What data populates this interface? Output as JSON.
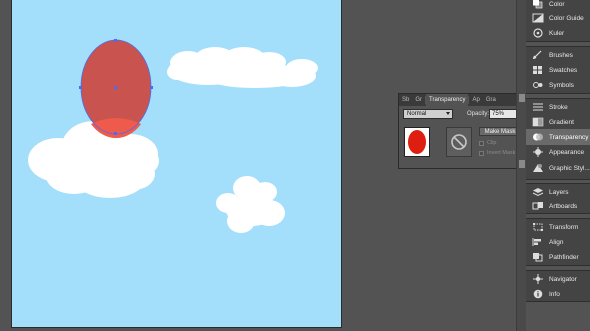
{
  "colors": {
    "workspace": "#535353",
    "artboard": "#a3defa",
    "balloon_fill": "#c9544f",
    "balloon_highlight": "#ee5a4c",
    "cloud": "#ffffff",
    "selection": "#4a6cf0",
    "thumb_red": "#dd1e10"
  },
  "transparency_panel": {
    "tabs": [
      {
        "label": "Sb"
      },
      {
        "label": "Gr"
      },
      {
        "label": "Transparency"
      },
      {
        "label": "Ap"
      },
      {
        "label": "Gra"
      }
    ],
    "active_tab": "Transparency",
    "blend_mode": "Normal",
    "opacity_label": "Opacity:",
    "opacity_value": "75%",
    "make_mask_label": "Make Mask",
    "clip_label": "Clip",
    "invert_mask_label": "Invert Mask"
  },
  "dock": {
    "items": [
      {
        "label": "Color",
        "icon": "color-icon"
      },
      {
        "label": "Color Guide",
        "icon": "color-guide-icon"
      },
      {
        "label": "Kuler",
        "icon": "kuler-icon"
      },
      {
        "label": "Brushes",
        "icon": "brushes-icon"
      },
      {
        "label": "Swatches",
        "icon": "swatches-icon"
      },
      {
        "label": "Symbols",
        "icon": "symbols-icon"
      },
      {
        "label": "Stroke",
        "icon": "stroke-icon"
      },
      {
        "label": "Gradient",
        "icon": "gradient-icon"
      },
      {
        "label": "Transparency",
        "icon": "transparency-icon"
      },
      {
        "label": "Appearance",
        "icon": "appearance-icon"
      },
      {
        "label": "Graphic Styl...",
        "icon": "graphic-styles-icon"
      },
      {
        "label": "Layers",
        "icon": "layers-icon"
      },
      {
        "label": "Artboards",
        "icon": "artboards-icon"
      },
      {
        "label": "Transform",
        "icon": "transform-icon"
      },
      {
        "label": "Align",
        "icon": "align-icon"
      },
      {
        "label": "Pathfinder",
        "icon": "pathfinder-icon"
      },
      {
        "label": "Navigator",
        "icon": "navigator-icon"
      },
      {
        "label": "Info",
        "icon": "info-icon"
      }
    ],
    "active_item": "Transparency"
  }
}
